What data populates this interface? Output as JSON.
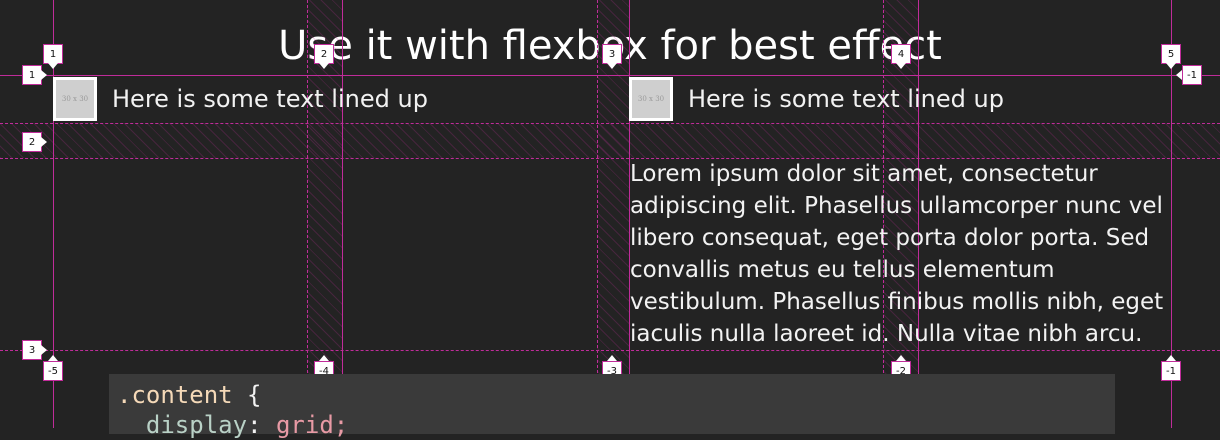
{
  "heading": "Use it with flexbox for best effect",
  "media": [
    {
      "thumb_label": "30 x 30",
      "text": "Here is some text lined up"
    },
    {
      "thumb_label": "30 x 30",
      "text": "Here is some text lined up"
    }
  ],
  "lorem": "Lorem ipsum dolor sit amet, consectetur adipiscing elit. Phasellus ullamcorper nunc vel libero consequat, eget porta dolor porta. Sed convallis metus eu tellus elementum vestibulum. Phasellus finibus mollis nibh, eget iaculis nulla laoreet id. Nulla vitae nibh arcu.",
  "grid_overlay": {
    "color": "#c02c9a",
    "column_labels_top": [
      "1",
      "2",
      "3",
      "4",
      "5"
    ],
    "column_labels_bottom": [
      "-5",
      "-4",
      "-3",
      "-2",
      "-1"
    ],
    "row_labels_left": [
      "1",
      "2",
      "3"
    ],
    "row_labels_right": [
      "-1"
    ]
  },
  "code": {
    "selector": ".content",
    "open_brace": "{",
    "property": "display",
    "colon": ":",
    "value": "grid;"
  }
}
